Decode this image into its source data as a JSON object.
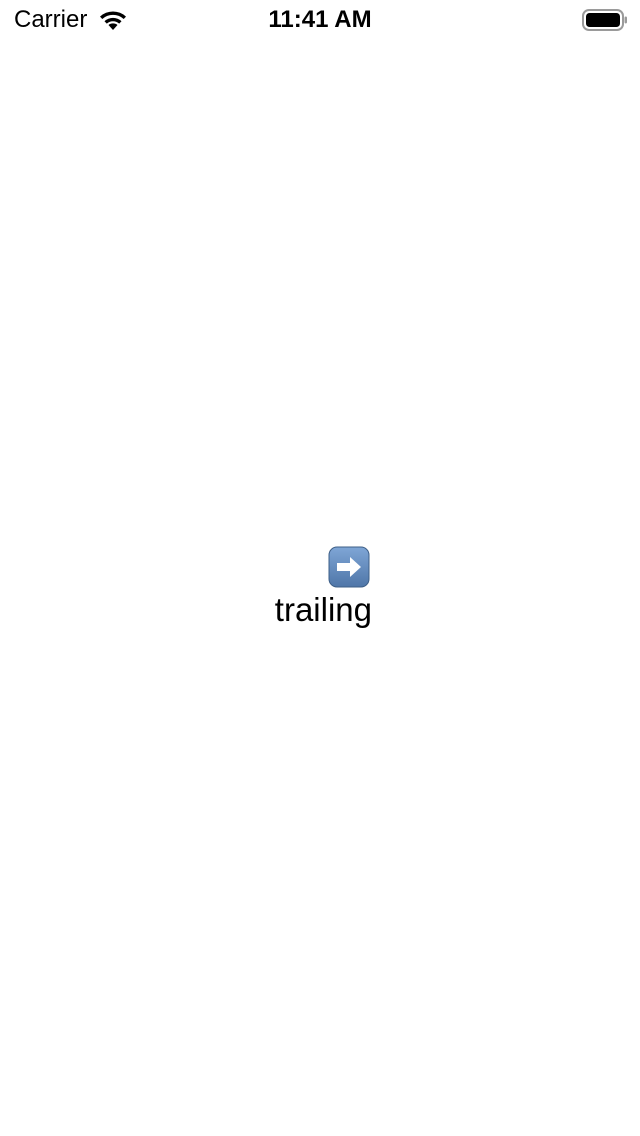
{
  "status_bar": {
    "carrier": "Carrier",
    "time": "11:41 AM",
    "wifi_icon": "wifi-icon",
    "battery_icon": "battery-icon"
  },
  "main": {
    "icon": "right-arrow-icon",
    "icon_color": "#5C83B4",
    "label": "trailing"
  }
}
